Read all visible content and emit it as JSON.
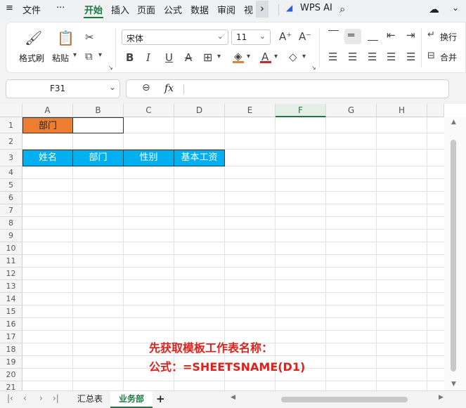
{
  "menu": {
    "hamburger_icon": "≡",
    "file": "文件",
    "more": "···",
    "tabs": [
      "开始",
      "插入",
      "页面",
      "公式",
      "数据",
      "审阅",
      "视"
    ],
    "wps_ai": "WPS AI"
  },
  "ribbon": {
    "format_painter": "格式刷",
    "paste": "粘贴",
    "font_name": "宋体",
    "font_size": "11",
    "bold": "B",
    "italic": "I",
    "underline": "U",
    "strikethrough": "A",
    "wrap": "换行",
    "merge": "合并"
  },
  "formula_bar": {
    "name_box": "F31",
    "fx": "fx",
    "content": ""
  },
  "columns": [
    "A",
    "B",
    "C",
    "D",
    "E",
    "F",
    "G",
    "H"
  ],
  "rows": [
    "1",
    "2",
    "3",
    "4",
    "5",
    "6",
    "7",
    "8",
    "9",
    "10",
    "11",
    "12",
    "13",
    "14",
    "15",
    "16",
    "17",
    "18",
    "19",
    "20",
    "21"
  ],
  "cells": {
    "A1": "部门",
    "B1": "",
    "A3": "姓名",
    "B3": "部门",
    "C3": "性别",
    "D3": "基本工资"
  },
  "annotation": {
    "line1": "先获取模板工作表名称：",
    "line2": "公式：=SHEETSNAME(D1)"
  },
  "sheets": {
    "tabs": [
      "汇总表",
      "业务部"
    ],
    "active": "业务部",
    "add": "+"
  },
  "colors": {
    "accent_green": "#1a7a3e",
    "header_orange": "#ed7d31",
    "header_blue": "#00b0f0",
    "annotation_red": "#e2201a"
  }
}
